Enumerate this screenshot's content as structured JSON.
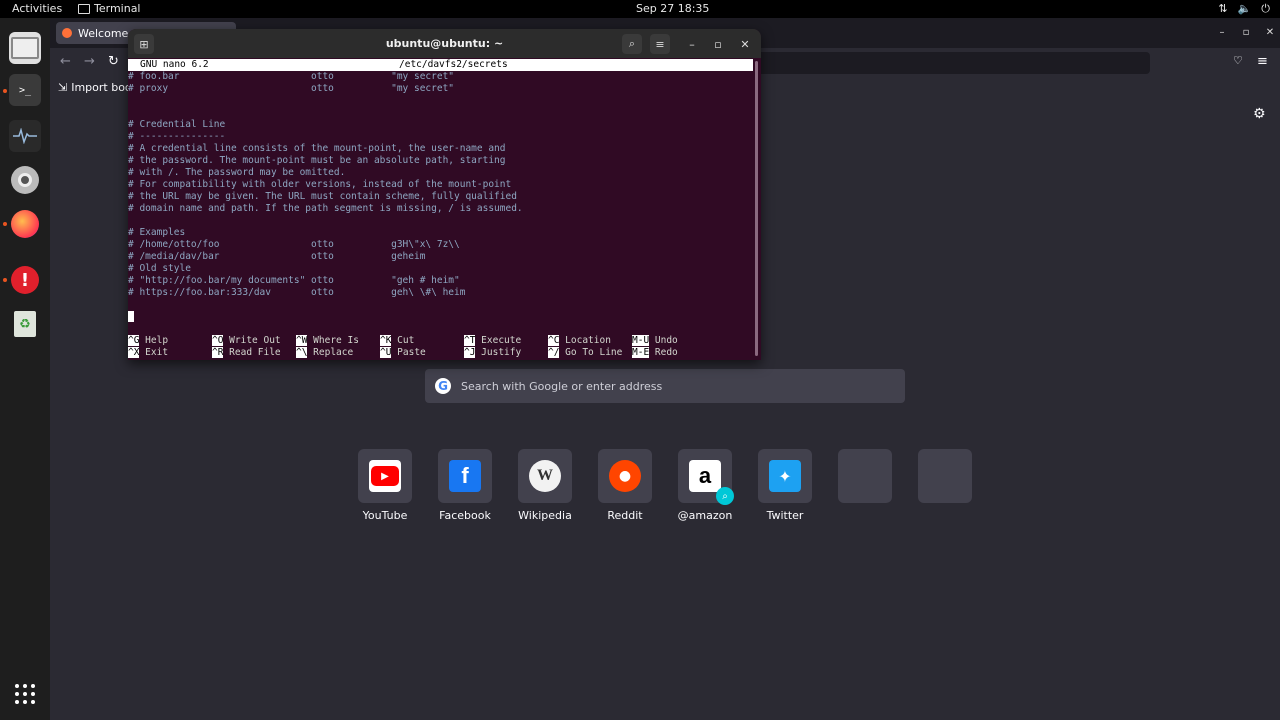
{
  "topbar": {
    "activities": "Activities",
    "app_name": "Terminal",
    "clock": "Sep 27  18:35"
  },
  "browser": {
    "tab_title": "Welcome to F",
    "bookmark": "Import book",
    "search_placeholder": "Search with Google or enter address",
    "search_logo": "G",
    "sites": [
      {
        "label": "YouTube",
        "icon": "youtube-icon",
        "color": "#ff0000",
        "glyph": "▶"
      },
      {
        "label": "Facebook",
        "icon": "facebook-icon",
        "color": "#1877f2",
        "glyph": "f"
      },
      {
        "label": "Wikipedia",
        "icon": "wikipedia-icon",
        "color": "#dcdcdc",
        "glyph": "W"
      },
      {
        "label": "Reddit",
        "icon": "reddit-icon",
        "color": "#ff4500",
        "glyph": "●"
      },
      {
        "label": "@amazon",
        "icon": "amazon-icon",
        "color": "#ffffff",
        "glyph": "a"
      },
      {
        "label": "Twitter",
        "icon": "twitter-icon",
        "color": "#1da1f2",
        "glyph": "✦"
      },
      {
        "label": "",
        "icon": "",
        "color": "",
        "glyph": ""
      },
      {
        "label": "",
        "icon": "",
        "color": "",
        "glyph": ""
      }
    ]
  },
  "terminal": {
    "title": "ubuntu@ubuntu: ~",
    "nano_version": "GNU nano 6.2",
    "file_path": "/etc/davfs2/secrets",
    "lines": [
      "# foo.bar                       otto          \"my secret\"",
      "# proxy                         otto          \"my secret\"",
      "",
      "",
      "# Credential Line",
      "# ---------------",
      "# A credential line consists of the mount-point, the user-name and",
      "# the password. The mount-point must be an absolute path, starting",
      "# with /. The password may be omitted.",
      "# For compatibility with older versions, instead of the mount-point",
      "# the URL may be given. The URL must contain scheme, fully qualified",
      "# domain name and path. If the path segment is missing, / is assumed.",
      "",
      "# Examples",
      "# /home/otto/foo                otto          g3H\\\"x\\ 7z\\\\",
      "# /media/dav/bar                otto          geheim",
      "# Old style",
      "# \"http://foo.bar/my documents\" otto          \"geh # heim\"",
      "# https://foo.bar:333/dav       otto          geh\\ \\#\\ heim"
    ],
    "shortcuts_row1": [
      {
        "key": "^G",
        "label": "Help"
      },
      {
        "key": "^O",
        "label": "Write Out"
      },
      {
        "key": "^W",
        "label": "Where Is"
      },
      {
        "key": "^K",
        "label": "Cut"
      },
      {
        "key": "^T",
        "label": "Execute"
      },
      {
        "key": "^C",
        "label": "Location"
      },
      {
        "key": "M-U",
        "label": "Undo"
      }
    ],
    "shortcuts_row2": [
      {
        "key": "^X",
        "label": "Exit"
      },
      {
        "key": "^R",
        "label": "Read File"
      },
      {
        "key": "^\\",
        "label": "Replace"
      },
      {
        "key": "^U",
        "label": "Paste"
      },
      {
        "key": "^J",
        "label": "Justify"
      },
      {
        "key": "^/",
        "label": "Go To Line"
      },
      {
        "key": "M-E",
        "label": "Redo"
      }
    ]
  },
  "colors": {
    "terminal_bg": "#300a24",
    "ubuntu_orange": "#e95420",
    "comment_blue": "#8ea7c2"
  }
}
